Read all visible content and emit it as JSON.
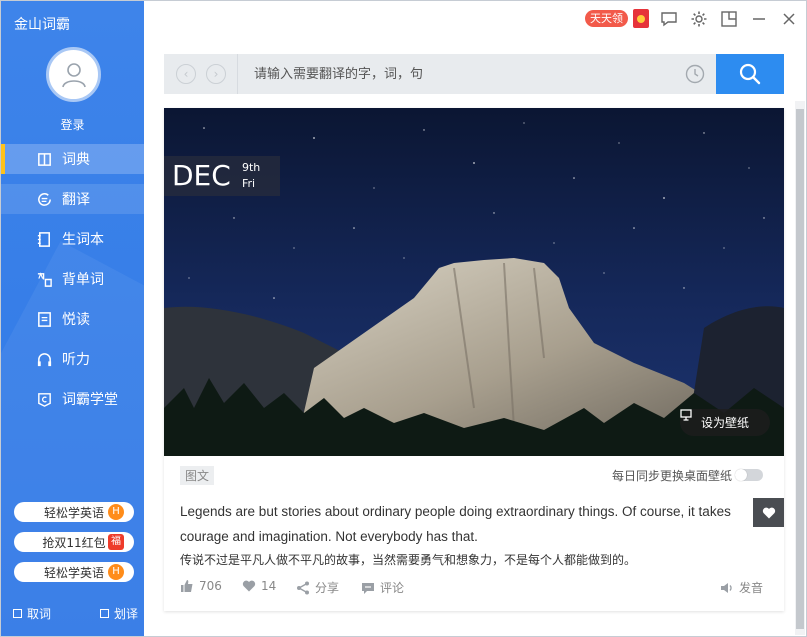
{
  "app": {
    "title": "金山词霸"
  },
  "user": {
    "login_label": "登录"
  },
  "nav": {
    "items": [
      {
        "label": "词典",
        "icon": "book-icon"
      },
      {
        "label": "翻译",
        "icon": "translate-icon"
      },
      {
        "label": "生词本",
        "icon": "notebook-icon"
      },
      {
        "label": "背单词",
        "icon": "word-card-icon"
      },
      {
        "label": "悦读",
        "icon": "reading-icon"
      },
      {
        "label": "听力",
        "icon": "headphones-icon"
      },
      {
        "label": "词霸学堂",
        "icon": "classroom-icon"
      }
    ],
    "active_index": 0
  },
  "promos": [
    {
      "label": "轻松学英语",
      "badge": "H"
    },
    {
      "label": "抢双11红包",
      "badge": "福"
    },
    {
      "label": "轻松学英语",
      "badge": "H"
    }
  ],
  "bottom": {
    "pick_word": "取词",
    "select_translate": "划译"
  },
  "topbar": {
    "badge": "天天领"
  },
  "search": {
    "placeholder": "请输入需要翻译的字，词，句"
  },
  "daily": {
    "month": "DEC",
    "day": "9th",
    "weekday": "Fri",
    "set_wallpaper": "设为壁纸",
    "tag": "图文",
    "sync_label": "每日同步更换桌面壁纸",
    "sync_on": false,
    "quote_en": "Legends are but stories about ordinary people doing extraordinary things. Of course, it takes courage and imagination. Not everybody has that.",
    "quote_cn": "传说不过是平凡人做不平凡的故事，当然需要勇气和想象力，不是每个人都能做到的。",
    "likes": "706",
    "favorites": "14",
    "share": "分享",
    "comment": "评论",
    "pronounce": "发音"
  },
  "colors": {
    "sidebar": "#3e84ea",
    "accent": "#2d8cf0",
    "active_bar": "#ffc21a"
  }
}
